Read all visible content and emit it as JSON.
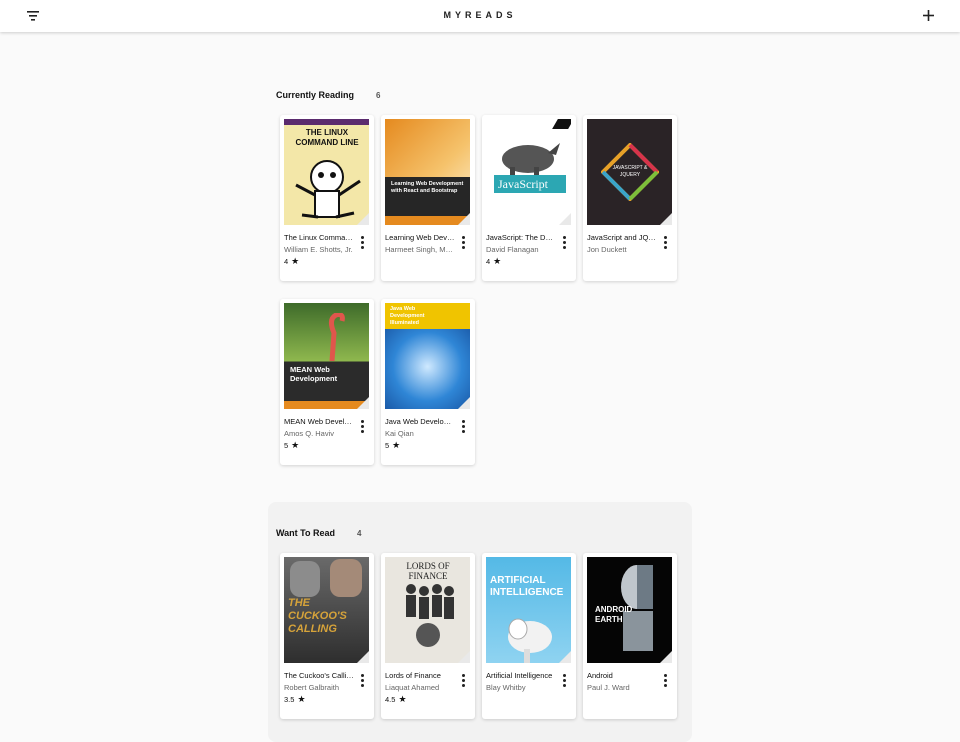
{
  "app": {
    "title": "MYREADS"
  },
  "shelves": [
    {
      "title": "Currently Reading",
      "count": "6",
      "books": [
        {
          "title": "The Linux Command Line",
          "author": "William E. Shotts, Jr.",
          "rating": "4",
          "cover_text": "THE LINUX COMMAND LINE"
        },
        {
          "title": "Learning Web Development with React and Bootstrap",
          "author": "Harmeet Singh, Mehul Bhatt",
          "rating": "",
          "cover_text": "Learning Web Development with React and Bootstrap"
        },
        {
          "title": "JavaScript: The Definitive Guide",
          "author": "David Flanagan",
          "rating": "4",
          "cover_text": "JavaScript"
        },
        {
          "title": "JavaScript and JQuery",
          "author": "Jon Duckett",
          "rating": "",
          "cover_text": "JAVASCRIPT & JQUERY"
        },
        {
          "title": "MEAN Web Development",
          "author": "Amos Q. Haviv",
          "rating": "5",
          "cover_text": "MEAN Web Development"
        },
        {
          "title": "Java Web Development Illuminated",
          "author": "Kai Qian",
          "rating": "5",
          "cover_text": "Java Web Development Illuminated"
        }
      ]
    },
    {
      "title": "Want To Read",
      "count": "4",
      "books": [
        {
          "title": "The Cuckoo's Calling",
          "author": "Robert Galbraith",
          "rating": "3.5",
          "cover_text": "THE CUCKOO'S CALLING"
        },
        {
          "title": "Lords of Finance",
          "author": "Liaquat Ahamed",
          "rating": "4.5",
          "cover_text": "LORDS OF FINANCE"
        },
        {
          "title": "Artificial Intelligence",
          "author": "Blay Whitby",
          "rating": "",
          "cover_text": "ARTIFICIAL INTELLIGENCE"
        },
        {
          "title": "Android",
          "author": "Paul J. Ward",
          "rating": "",
          "cover_text": "ANDROID EARTH"
        }
      ]
    }
  ],
  "icons": {
    "menu": "filter-list-icon",
    "add": "plus-icon",
    "more": "more-vert-icon",
    "star": "star-icon"
  }
}
